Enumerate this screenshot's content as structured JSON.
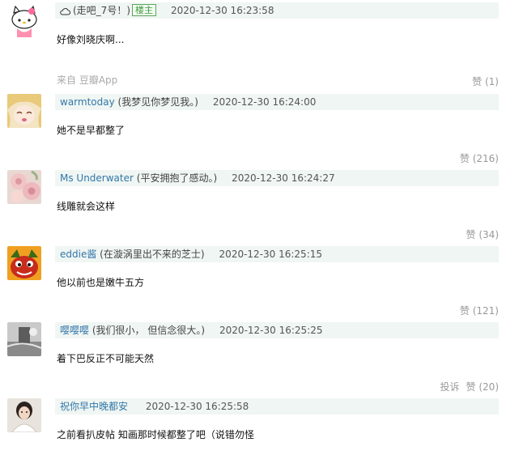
{
  "comments": [
    {
      "user": "",
      "status": "(走吧_7号！)",
      "op_badge": "楼主",
      "time": "2020-12-30 16:23:58",
      "text": "好像刘晓庆啊...",
      "source": "来自 豆瓣App",
      "likes": "赞 (1)",
      "avatar": "hello-kitty-avatar",
      "icon": "cloud-icon"
    },
    {
      "user": "warmtoday",
      "status": "(我梦见你梦见我。)",
      "time": "2020-12-30 16:24:00",
      "text": "她不是早都整了",
      "likes": "赞 (216)",
      "avatar": "anime-girl-avatar"
    },
    {
      "user": "Ms Underwater",
      "status": "(平安拥抱了感动。)",
      "time": "2020-12-30 16:24:27",
      "text": "线雕就会这样",
      "likes": "赞 (34)",
      "avatar": "roses-avatar"
    },
    {
      "user": "eddie酱",
      "status": "(在漩涡里出不来的芝士)",
      "time": "2020-12-30 16:25:15",
      "text": "他以前也是嫩牛五方",
      "likes": "赞 (121)",
      "avatar": "cartoon-creature-avatar"
    },
    {
      "user": "嘤嘤嘤",
      "status": "(我们很小， 但信念很大。)",
      "time": "2020-12-30 16:25:25",
      "text": "着下巴反正不可能天然",
      "likes": "赞 (20)",
      "report": "投诉",
      "avatar": "grey-photo-avatar"
    },
    {
      "user": "祝你早中晚都安",
      "status": "",
      "time": "2020-12-30 16:25:58",
      "text": "之前看扒皮帖 知画那时候都整了吧（说错勿怪",
      "avatar": "person-photo-avatar"
    }
  ],
  "colors": {
    "username": "#3377aa",
    "meta_bar": "#f0f6f3",
    "op_badge_border": "#5aa65a",
    "muted": "#999999"
  }
}
